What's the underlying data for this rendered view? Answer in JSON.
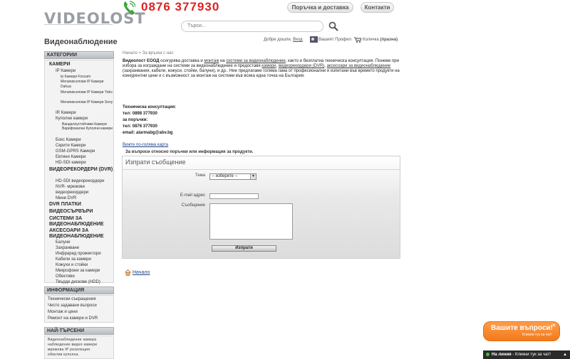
{
  "header": {
    "logo": "VIDEOLOST",
    "site_title": "Видеонаблюдение",
    "phone": "0876 377930",
    "btn_order": "Поръчка и доставка",
    "btn_contacts": "Контакти",
    "search_placeholder": "Търси...",
    "welcome": "Добре дошли,",
    "login": "Вход",
    "profile": "Вашият Профил",
    "cart": "Количка",
    "cart_status": "(празна)"
  },
  "sidebar": {
    "categories_title": "КАТЕГОРИИ",
    "categories": [
      {
        "label": "КАМЕРИ",
        "level": 0
      },
      {
        "label": "IP Камери",
        "level": 1
      },
      {
        "label": "Ip Камери Foscam",
        "level": 2
      },
      {
        "label": "Мегапикселови IP Камери Dahua",
        "level": 2
      },
      {
        "label": "Мегапикселови IP Камери Yoko",
        "level": 2
      },
      {
        "label": "Мегапикселови IP Камери Sony",
        "level": 2
      },
      {
        "label": "IR Камери",
        "level": 1
      },
      {
        "label": "Куполни камери",
        "level": 1
      },
      {
        "label": "Вандалоустойчиви Камери",
        "level": 3
      },
      {
        "label": "Варифокални Куполни камери",
        "level": 3
      },
      {
        "label": "Бокс Камери",
        "level": 1
      },
      {
        "label": "Скрити Камери",
        "level": 1
      },
      {
        "label": "GSM-GPRS Камери",
        "level": 1
      },
      {
        "label": "Евтини Камери",
        "level": 1
      },
      {
        "label": "HD-SDI камери",
        "level": 1
      },
      {
        "label": "ВИДЕОРЕКОРДЕРИ (DVR)",
        "level": 0
      },
      {
        "label": "HD-SDI видеорекордери",
        "level": 1
      },
      {
        "label": "NVR- мрежови видеорекордери",
        "level": 1
      },
      {
        "label": "Мини DVR",
        "level": 1
      },
      {
        "label": "DVR ПЛАТКИ",
        "level": 0
      },
      {
        "label": "ВИДЕОСЪРВЪРИ",
        "level": 0
      },
      {
        "label": "СИСТЕМИ ЗА ВИДЕОНАБЛЮДЕНИЕ",
        "level": 0
      },
      {
        "label": "АКСЕСОАРИ ЗА ВИДЕОНАБЛЮДЕНИЕ",
        "level": 0
      },
      {
        "label": "Балуни",
        "level": 1
      },
      {
        "label": "Захранване",
        "level": 1
      },
      {
        "label": "Инфраред прожектори",
        "level": 1
      },
      {
        "label": "Кабели за камери",
        "level": 1
      },
      {
        "label": "Кожухи и стойки",
        "level": 1
      },
      {
        "label": "Микрофони за камери",
        "level": 1
      },
      {
        "label": "Обективи",
        "level": 1
      },
      {
        "label": "Твърди дискове (HDD)",
        "level": 1
      }
    ],
    "info_title": "ИНФОРМАЦИЯ",
    "info_items": [
      "Технически съкращения",
      "Често задавани въпроси",
      "Монтаж и цени",
      "Ремонт на камери и DVR"
    ],
    "top_title": "НАЙ-ТЪРСЕНИ",
    "top_lines": [
      "Видеонаблюдение камера",
      "наблюдение видео камери",
      "мрежова IP резолюция",
      "обектив куполна"
    ]
  },
  "content": {
    "breadcrumb": "Начало > За връзка с нас",
    "intro": {
      "company": "Видеолост ЕООД",
      "t1": " осигурява доставка и ",
      "l1": "монтаж",
      "t2": " на ",
      "l2": "системи за видеонаблюдение",
      "t3": ", както и безплатна техническа консултация. Понеже при избора за изграждане на системи  за видеонаблюдение и предоставя ",
      "l3": "камери",
      "t4": ", ",
      "l4": "видеорекордери (DVR)",
      "t5": ", ",
      "l5": "аксесоари за видеонаблюдение",
      "t6": " (захранвания, кабели, кожуси, стойки, балуни), и др.. Ние предлагаме голяма гама от професионални и изпитани във времето продукти на конкурентни цени и с възможност за монтаж на системи във всяка една точка на България."
    },
    "contacts": [
      "Техническа консултация:",
      "тел: 0898 377930",
      "за поръчки:",
      "тел: 0876 377930",
      "email: alarmabg@abv.bg"
    ],
    "map_link": "Вижте по-голяма карта",
    "note": "За въпроси относно поръчки или информация за продукти.",
    "form": {
      "title": "Изпрати съобщение",
      "topic_label": "Тема",
      "topic_value": "-- изберете --",
      "email_label": "E-mail адрес",
      "message_label": "Съобщение",
      "submit": "Изпрати"
    },
    "home": "Начало"
  },
  "chat": {
    "title": "Вашите въпроси!",
    "subtitle": "Кликни тук за чат!",
    "close": "×",
    "bar_online": "На линия",
    "bar_text": " - Кликни тук за чат!"
  }
}
